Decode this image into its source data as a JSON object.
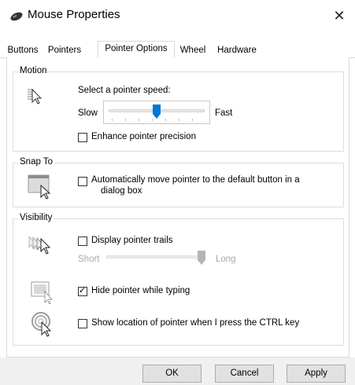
{
  "window": {
    "title": "Mouse Properties",
    "close_glyph": "✕",
    "icon": "mouse-icon"
  },
  "tabs": [
    {
      "label": "Buttons",
      "active": false
    },
    {
      "label": "Pointers",
      "active": false
    },
    {
      "label": "Pointer Options",
      "active": true
    },
    {
      "label": "Wheel",
      "active": false
    },
    {
      "label": "Hardware",
      "active": false
    }
  ],
  "motion": {
    "group_label": "Motion",
    "heading": "Select a pointer speed:",
    "slow_label": "Slow",
    "fast_label": "Fast",
    "speed_level": 0.5,
    "enhance_label": "Enhance pointer precision",
    "enhance_checked": false,
    "icon": "pointer-speed-icon"
  },
  "snap_to": {
    "group_label": "Snap To",
    "label_line1": "Automatically move pointer to the default button in a",
    "label_line2": "dialog box",
    "checked": false,
    "icon": "snap-to-icon"
  },
  "visibility": {
    "group_label": "Visibility",
    "trails_label": "Display pointer trails",
    "trails_checked": false,
    "short_label": "Short",
    "long_label": "Long",
    "trail_level": 1.0,
    "hide_label": "Hide pointer while typing",
    "hide_checked": true,
    "show_label": "Show location of pointer when I press the CTRL key",
    "show_checked": false,
    "check_glyph": "✓",
    "icons": [
      "pointer-trails-icon",
      "hide-pointer-icon",
      "show-location-icon"
    ]
  },
  "footer": {
    "ok_label": "OK",
    "cancel_label": "Cancel",
    "apply_label": "Apply"
  },
  "colors": {
    "accent": "#0078d7",
    "disabled_text": "#a9a9a9",
    "border": "#dcdcdc"
  }
}
